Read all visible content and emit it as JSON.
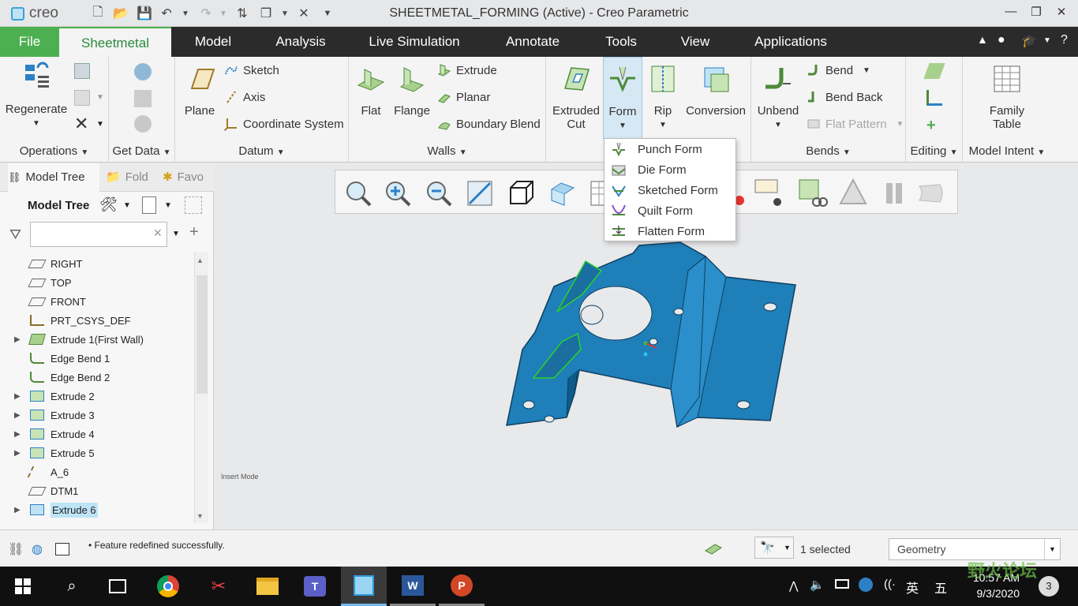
{
  "window": {
    "app_name": "creo",
    "title": "SHEETMETAL_FORMING (Active) - Creo Parametric"
  },
  "menubar": {
    "items": [
      "File",
      "Sheetmetal",
      "Model",
      "Analysis",
      "Live Simulation",
      "Annotate",
      "Tools",
      "View",
      "Applications"
    ],
    "active": "Sheetmetal"
  },
  "ribbon": {
    "operations": {
      "regenerate": "Regenerate",
      "group": "Operations"
    },
    "get_data": {
      "group": "Get Data"
    },
    "datum": {
      "plane": "Plane",
      "sketch": "Sketch",
      "axis": "Axis",
      "coordinate_system": "Coordinate System",
      "group": "Datum"
    },
    "walls": {
      "flat": "Flat",
      "flange": "Flange",
      "extrude": "Extrude",
      "planar": "Planar",
      "boundary_blend": "Boundary Blend",
      "group": "Walls"
    },
    "engineering": {
      "extruded_cut_1": "Extruded",
      "extruded_cut_2": "Cut",
      "form": "Form",
      "rip": "Rip",
      "conversion": "Conversion"
    },
    "bends": {
      "unbend": "Unbend",
      "bend": "Bend",
      "bend_back": "Bend Back",
      "flat_pattern": "Flat Pattern",
      "group": "Bends"
    },
    "editing": {
      "group": "Editing"
    },
    "model_intent": {
      "family_table_1": "Family",
      "family_table_2": "Table",
      "group": "Model Intent"
    }
  },
  "form_menu": {
    "items": [
      "Punch Form",
      "Die Form",
      "Sketched Form",
      "Quilt Form",
      "Flatten Form"
    ]
  },
  "left_panel": {
    "tabs": [
      "Model Tree",
      "Fold",
      "Favo"
    ],
    "header": "Model Tree",
    "search_placeholder": "",
    "tree": [
      {
        "label": "RIGHT",
        "expandable": false,
        "icon": "datum-plane-icon"
      },
      {
        "label": "TOP",
        "expandable": false,
        "icon": "datum-plane-icon"
      },
      {
        "label": "FRONT",
        "expandable": false,
        "icon": "datum-plane-icon"
      },
      {
        "label": "PRT_CSYS_DEF",
        "expandable": false,
        "icon": "csys-icon"
      },
      {
        "label": "Extrude 1(First Wall)",
        "expandable": true,
        "icon": "first-wall-icon"
      },
      {
        "label": "Edge Bend 1",
        "expandable": false,
        "icon": "edge-bend-icon"
      },
      {
        "label": "Edge Bend 2",
        "expandable": false,
        "icon": "edge-bend-icon"
      },
      {
        "label": "Extrude 2",
        "expandable": true,
        "icon": "extrude-cut-icon"
      },
      {
        "label": "Extrude 3",
        "expandable": true,
        "icon": "extrude-cut-icon"
      },
      {
        "label": "Extrude 4",
        "expandable": true,
        "icon": "extrude-cut-icon"
      },
      {
        "label": "Extrude 5",
        "expandable": true,
        "icon": "extrude-cut-icon"
      },
      {
        "label": "A_6",
        "expandable": false,
        "icon": "axis-icon"
      },
      {
        "label": "DTM1",
        "expandable": false,
        "icon": "datum-plane-icon"
      },
      {
        "label": "Extrude 6",
        "expandable": true,
        "icon": "extrude-solid-icon",
        "selected": true
      }
    ]
  },
  "graphics": {
    "mode_text": "Insert Mode"
  },
  "statusbar": {
    "message": "Feature redefined successfully.",
    "selection": "1 selected",
    "filter": "Geometry"
  },
  "taskbar": {
    "time": "10:57 AM",
    "date": "9/3/2020",
    "ime_1": "英",
    "ime_2": "五",
    "notifications": "3",
    "watermark": "野火论坛"
  },
  "colors": {
    "accent": "#4caf50",
    "menubar": "#2b2b2b",
    "part": "#1f7fb8",
    "selection": "#bde4f7"
  }
}
